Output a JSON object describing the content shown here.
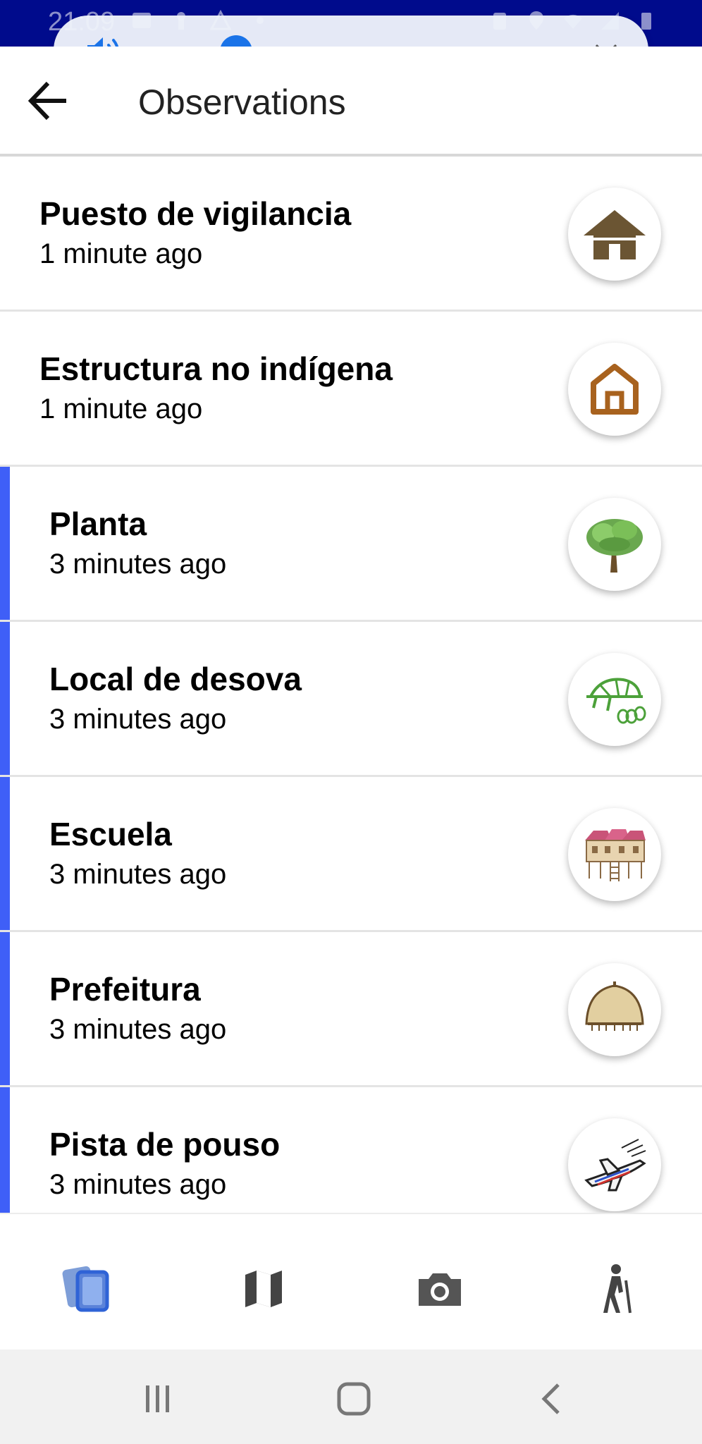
{
  "status_bar": {
    "time": "21:09",
    "bg_color": "#000b8c",
    "left_icons": [
      "gallery-icon",
      "keyhole-icon",
      "recycle-icon",
      "dot-icon"
    ],
    "right_icons": [
      "battery-saver-icon",
      "location-icon",
      "wifi-icon",
      "signal-icon",
      "battery-icon"
    ]
  },
  "volume_panel": {
    "level_fraction": 0.19,
    "accent_color": "#1a73e8",
    "icon": "speaker-volume-icon",
    "expand_icon": "chevron-down-icon"
  },
  "header": {
    "title": "Observations",
    "back_icon": "arrow-left-icon"
  },
  "observations": [
    {
      "title": "Puesto de vigilancia",
      "time": "1 minute ago",
      "synced": false,
      "icon": "house-roof-icon"
    },
    {
      "title": "Estructura no indígena",
      "time": "1 minute ago",
      "synced": false,
      "icon": "house-outline-icon"
    },
    {
      "title": "Planta",
      "time": "3 minutes ago",
      "synced": true,
      "icon": "tree-icon"
    },
    {
      "title": "Local de desova",
      "time": "3 minutes ago",
      "synced": true,
      "icon": "turtle-eggs-icon"
    },
    {
      "title": "Escuela",
      "time": "3 minutes ago",
      "synced": true,
      "icon": "school-building-icon"
    },
    {
      "title": "Prefeitura",
      "time": "3 minutes ago",
      "synced": true,
      "icon": "thatched-hut-icon"
    },
    {
      "title": "Pista de pouso",
      "time": "3 minutes ago",
      "synced": true,
      "icon": "airplane-icon"
    }
  ],
  "sync_indicator_color": "#3f5ff7",
  "bottom_nav": {
    "items": [
      "observations-list-icon",
      "map-icon",
      "camera-icon",
      "hiker-icon"
    ],
    "active": "observations-list-icon"
  },
  "system_nav": [
    "recent-apps-icon",
    "home-icon",
    "back-icon"
  ]
}
